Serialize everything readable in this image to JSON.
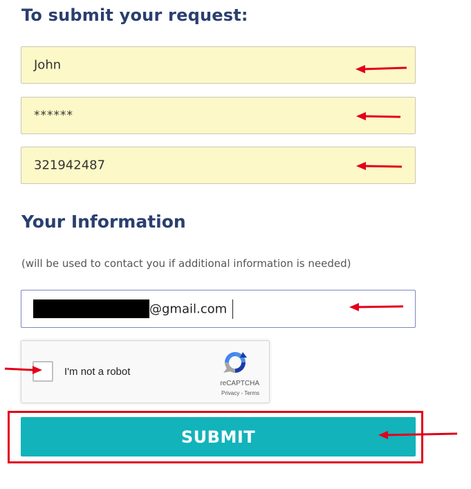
{
  "form": {
    "request_heading": "To submit your request:",
    "field_name": "John",
    "field_password": "******",
    "field_number": "321942487",
    "info_heading": "Your Information",
    "info_note": "(will be used to contact you if additional information is needed)",
    "email_value": "@gmail.com"
  },
  "captcha": {
    "label": "I'm not a robot",
    "brand": "reCAPTCHA",
    "links": "Privacy - Terms"
  },
  "submit": {
    "label": "SUBMIT"
  },
  "colors": {
    "heading": "#2a3f6f",
    "field_bg": "#fdf8c7",
    "submit_bg": "#12b3bb",
    "annotation_red": "#e2001a"
  },
  "annotations": {
    "arrow_icon": "left-arrow-icon"
  }
}
